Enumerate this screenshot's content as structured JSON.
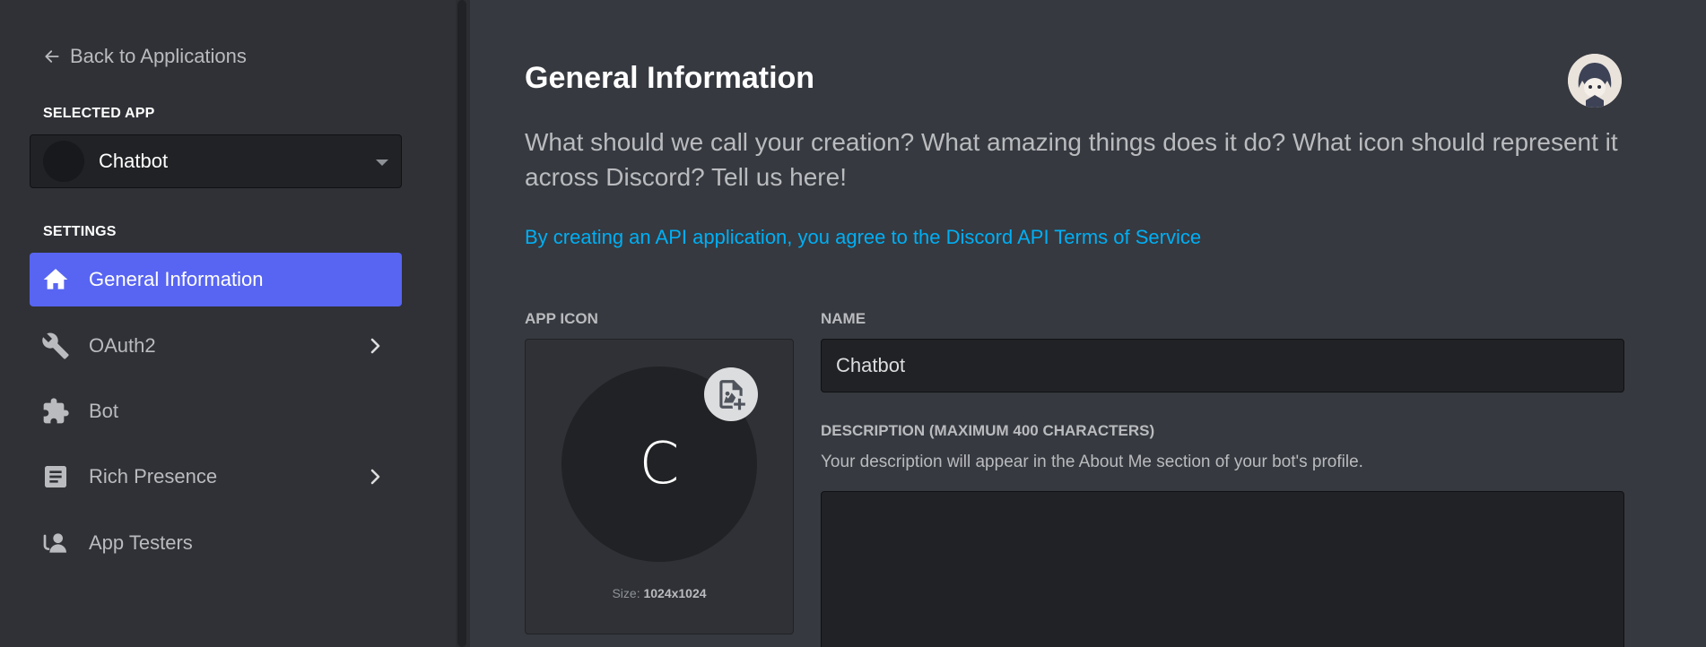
{
  "sidebar": {
    "back_label": "Back to Applications",
    "selected_app_label": "SELECTED APP",
    "selected_app_name": "Chatbot",
    "settings_label": "SETTINGS",
    "items": [
      {
        "label": "General Information",
        "icon": "home-icon",
        "active": true
      },
      {
        "label": "OAuth2",
        "icon": "wrench-icon",
        "has_submenu": true
      },
      {
        "label": "Bot",
        "icon": "puzzle-icon"
      },
      {
        "label": "Rich Presence",
        "icon": "document-icon",
        "has_submenu": true
      },
      {
        "label": "App Testers",
        "icon": "user-icon"
      }
    ]
  },
  "main": {
    "title": "General Information",
    "subtitle": "What should we call your creation? What amazing things does it do? What icon should represent it across Discord? Tell us here!",
    "tos_link": "By creating an API application, you agree to the Discord API Terms of Service",
    "app_icon": {
      "label": "APP ICON",
      "initial": "C",
      "size_prefix": "Size:",
      "size_value": "1024x1024"
    },
    "name_field": {
      "label": "NAME",
      "value": "Chatbot"
    },
    "description_field": {
      "label": "DESCRIPTION (MAXIMUM 400 CHARACTERS)",
      "hint": "Your description will appear in the About Me section of your bot's profile.",
      "value": ""
    }
  },
  "colors": {
    "accent": "#5865f2",
    "link": "#00aff4",
    "background": "#36393f",
    "sidebar": "#2f3136"
  }
}
